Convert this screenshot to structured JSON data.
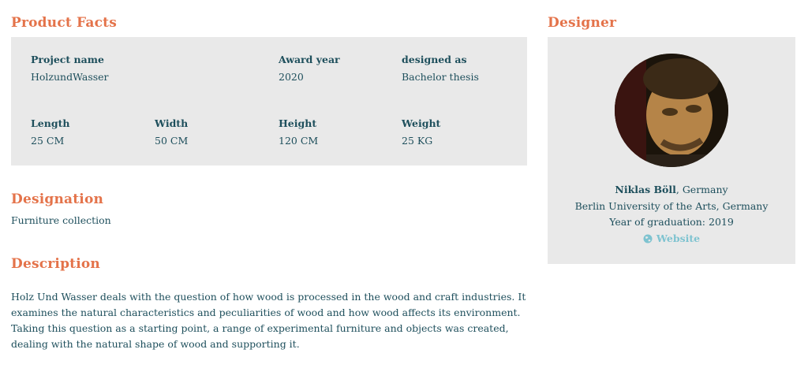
{
  "product_facts": {
    "heading": "Product Facts",
    "project_name_label": "Project name",
    "project_name": "HolzundWasser",
    "award_year_label": "Award year",
    "award_year": "2020",
    "designed_as_label": "designed as",
    "designed_as": "Bachelor thesis",
    "length_label": "Length",
    "length": "25 CM",
    "width_label": "Width",
    "width": "50 CM",
    "height_label": "Height",
    "height": "120 CM",
    "weight_label": "Weight",
    "weight": "25 KG"
  },
  "designation": {
    "heading": "Designation",
    "text": "Furniture collection"
  },
  "description": {
    "heading": "Description",
    "text": "Holz Und Wasser deals with the question of how wood is processed in the wood and craft industries. It examines the natural characteristics and peculiarities of wood and how wood affects its environment. Taking this question as a starting point, a range of experimental furniture and objects was created, dealing with the natural shape of wood and supporting it."
  },
  "designer": {
    "heading": "Designer",
    "name": "Niklas Böll",
    "country_suffix": ", Germany",
    "university": "Berlin University of the Arts, Germany",
    "graduation": "Year of graduation: 2019",
    "website_label": "Website",
    "website_icon": "globe-icon"
  },
  "colors": {
    "heading": "#e4734a",
    "text": "#1e4f5c",
    "link": "#7ec3d0",
    "panel": "#e9e9e9"
  }
}
